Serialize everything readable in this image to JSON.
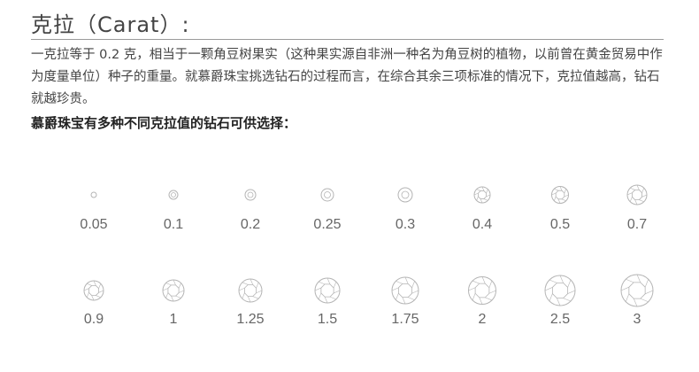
{
  "header": {
    "title": "克拉（Carat）:"
  },
  "content": {
    "description": "一克拉等于 0.2 克，相当于一颗角豆树果实（这种果实源自非洲一种名为角豆树的植物，以前曾在黄金贸易中作为度量单位）种子的重量。就慕爵珠宝挑选钻石的过程而言，在综合其余三项标准的情况下，克拉值越高，钻石就越珍贵。",
    "lead": "慕爵珠宝有多种不同克拉值的钻石可供选择："
  },
  "diamonds": {
    "row1": [
      "0.05",
      "0.1",
      "0.2",
      "0.25",
      "0.3",
      "0.4",
      "0.5",
      "0.7"
    ],
    "row2": [
      "0.9",
      "1",
      "1.25",
      "1.5",
      "1.75",
      "2",
      "2.5",
      "3"
    ]
  },
  "colors": {
    "stone_stroke": "#b4b4b4",
    "text": "#444444",
    "value_text": "#666666"
  }
}
